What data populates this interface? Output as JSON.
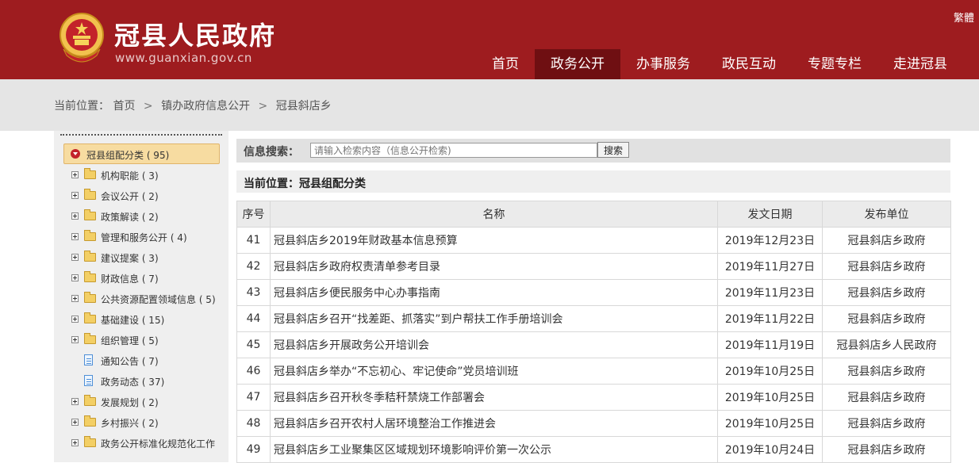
{
  "header": {
    "site_title": "冠县人民政府",
    "site_url": "www.guanxian.gov.cn",
    "lang_toggle": "繁體",
    "nav": [
      "首页",
      "政务公开",
      "办事服务",
      "政民互动",
      "专题专栏",
      "走进冠县"
    ],
    "active_nav": "政务公开"
  },
  "breadcrumb": {
    "label": "当前位置：",
    "items": [
      "首页",
      "镇办政府信息公开",
      "冠县斜店乡"
    ],
    "separator": ">"
  },
  "sidebar": {
    "root": "冠县组配分类 ( 95)",
    "items": [
      {
        "label": "机构职能 ( 3)",
        "icon": "folder"
      },
      {
        "label": "会议公开 ( 2)",
        "icon": "folder"
      },
      {
        "label": "政策解读 ( 2)",
        "icon": "folder"
      },
      {
        "label": "管理和服务公开 ( 4)",
        "icon": "folder"
      },
      {
        "label": "建议提案 ( 3)",
        "icon": "folder"
      },
      {
        "label": "财政信息 ( 7)",
        "icon": "folder"
      },
      {
        "label": "公共资源配置领域信息 ( 5)",
        "icon": "folder"
      },
      {
        "label": "基础建设 ( 15)",
        "icon": "folder"
      },
      {
        "label": "组织管理 ( 5)",
        "icon": "folder"
      },
      {
        "label": "通知公告 ( 7)",
        "icon": "document"
      },
      {
        "label": "政务动态 ( 37)",
        "icon": "document"
      },
      {
        "label": "发展规划 ( 2)",
        "icon": "folder"
      },
      {
        "label": "乡村振兴 ( 2)",
        "icon": "folder"
      },
      {
        "label": "政务公开标准化规范化工作",
        "icon": "folder"
      }
    ]
  },
  "search": {
    "label": "信息搜索：",
    "placeholder": "请输入检索内容（信息公开检索)",
    "button": "搜索"
  },
  "section_title": "当前位置：冠县组配分类",
  "table": {
    "headers": [
      "序号",
      "名称",
      "发文日期",
      "发布单位"
    ],
    "rows": [
      [
        "41",
        "冠县斜店乡2019年财政基本信息预算",
        "2019年12月23日",
        "冠县斜店乡政府"
      ],
      [
        "42",
        "冠县斜店乡政府权责清单参考目录",
        "2019年11月27日",
        "冠县斜店乡政府"
      ],
      [
        "43",
        "冠县斜店乡便民服务中心办事指南",
        "2019年11月23日",
        "冠县斜店乡政府"
      ],
      [
        "44",
        "冠县斜店乡召开“找差距、抓落实”到户帮扶工作手册培训会",
        "2019年11月22日",
        "冠县斜店乡政府"
      ],
      [
        "45",
        "冠县斜店乡开展政务公开培训会",
        "2019年11月19日",
        "冠县斜店乡人民政府"
      ],
      [
        "46",
        "冠县斜店乡举办“不忘初心、牢记使命”党员培训班",
        "2019年10月25日",
        "冠县斜店乡政府"
      ],
      [
        "47",
        "冠县斜店乡召开秋冬季秸秆禁烧工作部署会",
        "2019年10月25日",
        "冠县斜店乡政府"
      ],
      [
        "48",
        "冠县斜店乡召开农村人居环境整治工作推进会",
        "2019年10月25日",
        "冠县斜店乡政府"
      ],
      [
        "49",
        "冠县斜店乡工业聚集区区域规划环境影响评价第一次公示",
        "2019年10月24日",
        "冠县斜店乡政府"
      ]
    ]
  },
  "colors": {
    "header_red": "#9e1c1f",
    "nav_active": "#6f0f12",
    "crumb_bg": "#e5e5e5",
    "tree_root_bg": "#f7dca1"
  }
}
